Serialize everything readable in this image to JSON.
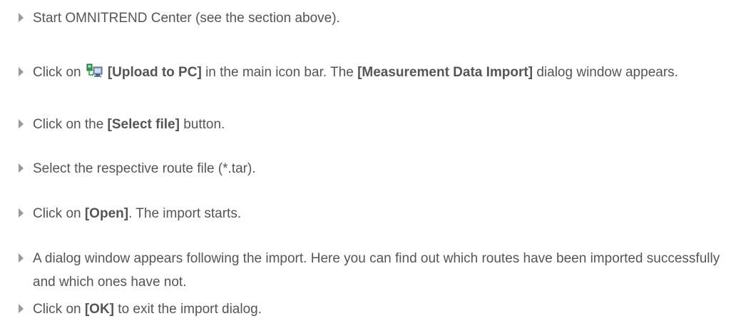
{
  "steps": [
    {
      "parts": [
        {
          "text": "Start OMNITREND Center (see the section above)."
        }
      ]
    },
    {
      "parts": [
        {
          "text": "Click on "
        },
        {
          "icon": "upload-to-pc-icon"
        },
        {
          "text": "[Upload to PC]",
          "bold": true
        },
        {
          "text": " in the main icon bar. The "
        },
        {
          "text": "[Measurement Data Import]",
          "bold": true
        },
        {
          "text": " dialog window appears."
        }
      ]
    },
    {
      "parts": [
        {
          "text": "Click on the "
        },
        {
          "text": "[Select file]",
          "bold": true
        },
        {
          "text": " button."
        }
      ]
    },
    {
      "parts": [
        {
          "text": "Select the respective route file (*.tar)."
        }
      ]
    },
    {
      "parts": [
        {
          "text": "Click on "
        },
        {
          "text": "[Open]",
          "bold": true
        },
        {
          "text": ". The import starts."
        }
      ]
    },
    {
      "parts": [
        {
          "text": "A dialog window appears following the import. Here you can find out which routes have been imported successfully and which ones have not."
        }
      ]
    },
    {
      "parts": [
        {
          "text": "Click on "
        },
        {
          "text": "[OK]",
          "bold": true
        },
        {
          "text": " to exit the import dialog."
        }
      ]
    }
  ],
  "colors": {
    "text": "#555555",
    "bullet": "#9a9a9a",
    "background": "#ffffff"
  }
}
